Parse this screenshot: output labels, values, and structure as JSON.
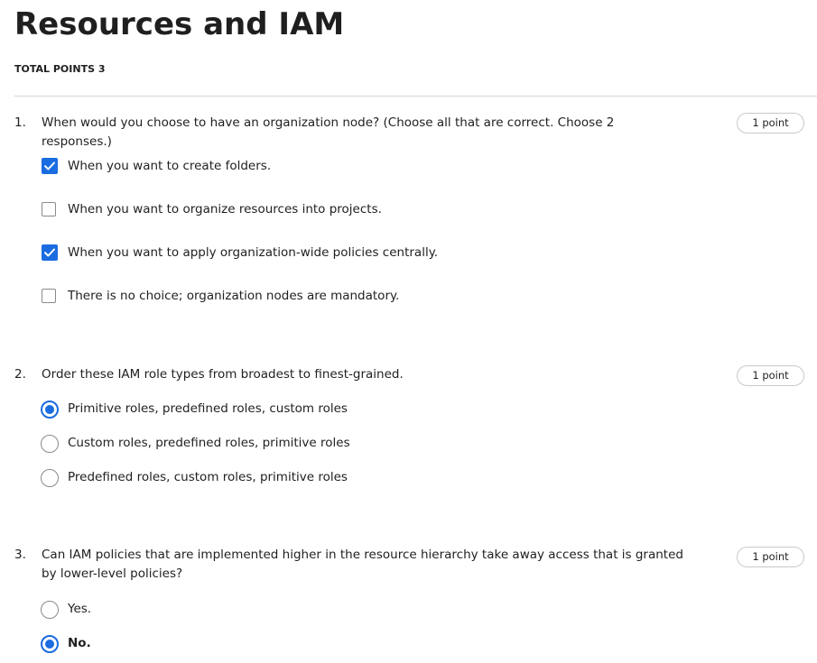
{
  "header": {
    "title": "Resources and IAM",
    "total_points": "TOTAL POINTS 3"
  },
  "colors": {
    "accent": "#1a6ce0",
    "text": "#1f1f1f",
    "border": "#c9c9c9"
  },
  "questions": [
    {
      "number": "1.",
      "text": "When would you choose to have an organization node? (Choose all that are correct. Choose 2 responses.)",
      "points": "1 point",
      "type": "checkbox",
      "options": [
        {
          "label": "When you want to create folders.",
          "checked": true
        },
        {
          "label": "When you want to organize resources into projects.",
          "checked": false
        },
        {
          "label": "When you want to apply organization-wide policies centrally.",
          "checked": true
        },
        {
          "label": "There is no choice; organization nodes are mandatory.",
          "checked": false
        }
      ]
    },
    {
      "number": "2.",
      "text": "Order these IAM role types from broadest to finest-grained.",
      "points": "1 point",
      "type": "radio",
      "options": [
        {
          "label": "Primitive roles, predefined roles, custom roles",
          "checked": true
        },
        {
          "label": "Custom roles, predefined roles, primitive roles",
          "checked": false
        },
        {
          "label": "Predefined roles, custom roles, primitive roles",
          "checked": false
        }
      ]
    },
    {
      "number": "3.",
      "text": "Can IAM policies that are implemented higher in the resource hierarchy take away access that is granted by lower-level policies?",
      "points": "1 point",
      "type": "radio",
      "options": [
        {
          "label": "Yes.",
          "checked": false
        },
        {
          "label": "No.",
          "checked": true
        }
      ]
    }
  ]
}
